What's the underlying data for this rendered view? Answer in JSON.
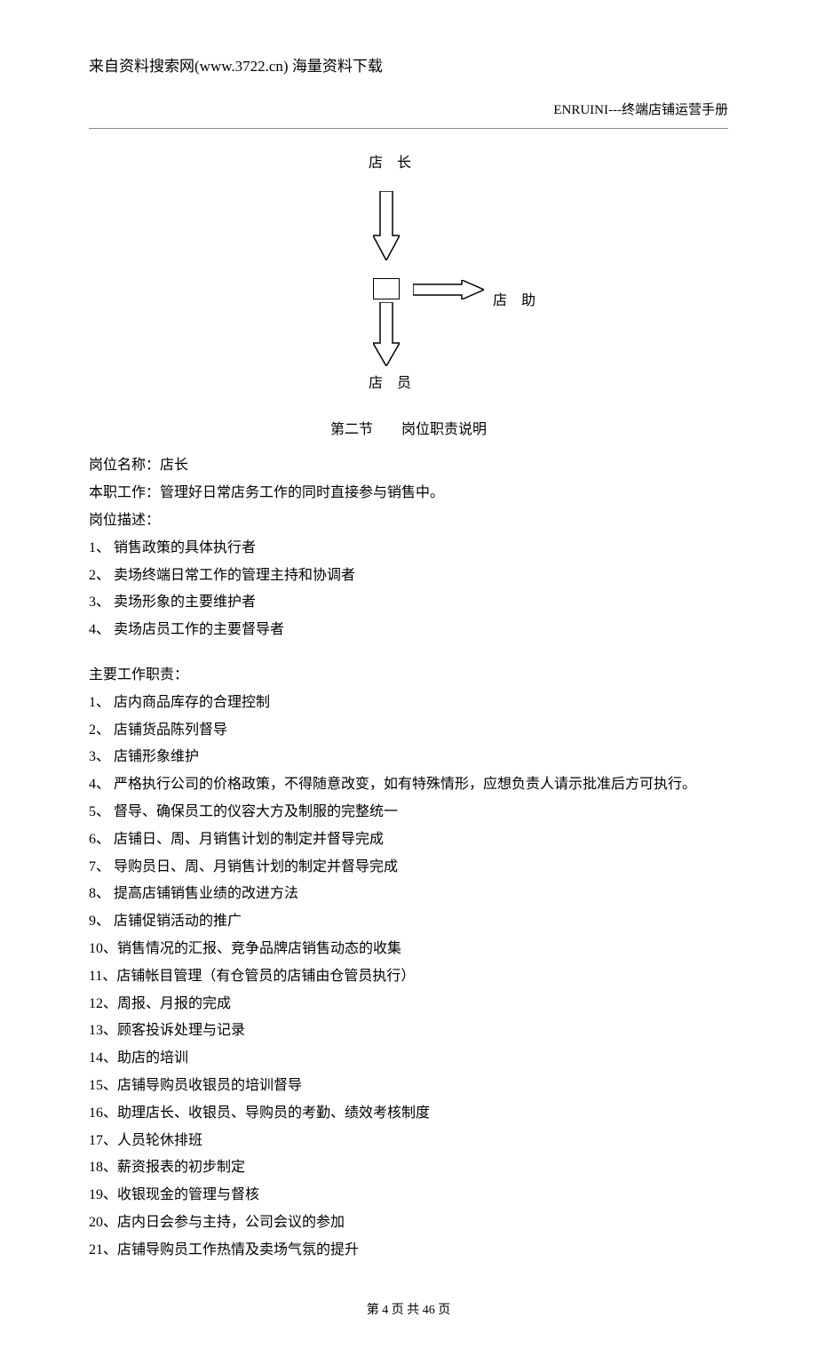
{
  "source_header": "来自资料搜索网(www.3722.cn) 海量资料下载",
  "doc_title": "ENRUINI---终端店铺运营手册",
  "org": {
    "top": "店 长",
    "side": "店  助",
    "bottom": "店  员"
  },
  "section": {
    "num": "第二节",
    "title": "岗位职责说明"
  },
  "position": {
    "name_label": "岗位名称：店长",
    "work_label": "本职工作：管理好日常店务工作的同时直接参与销售中。",
    "desc_label": "岗位描述：",
    "desc_items": [
      "1、 销售政策的具体执行者",
      "2、 卖场终端日常工作的管理主持和协调者",
      "3、 卖场形象的主要维护者",
      "4、 卖场店员工作的主要督导者"
    ],
    "duty_label": "主要工作职责：",
    "duty_items": [
      "1、 店内商品库存的合理控制",
      "2、 店铺货品陈列督导",
      "3、 店铺形象维护",
      "4、 严格执行公司的价格政策，不得随意改变，如有特殊情形，应想负责人请示批准后方可执行。",
      "5、 督导、确保员工的仪容大方及制服的完整统一",
      "6、 店铺日、周、月销售计划的制定并督导完成",
      "7、 导购员日、周、月销售计划的制定并督导完成",
      "8、 提高店铺销售业绩的改进方法",
      "9、 店铺促销活动的推广",
      "10、销售情况的汇报、竞争品牌店销售动态的收集",
      "11、店铺帐目管理（有仓管员的店铺由仓管员执行）",
      "12、周报、月报的完成",
      "13、顾客投诉处理与记录",
      "14、助店的培训",
      "15、店铺导购员收银员的培训督导",
      "16、助理店长、收银员、导购员的考勤、绩效考核制度",
      "17、人员轮休排班",
      "18、薪资报表的初步制定",
      "19、收银现金的管理与督核",
      "20、店内日会参与主持，公司会议的参加",
      "21、店铺导购员工作热情及卖场气氛的提升"
    ]
  },
  "footer": "第 4 页 共 46 页"
}
